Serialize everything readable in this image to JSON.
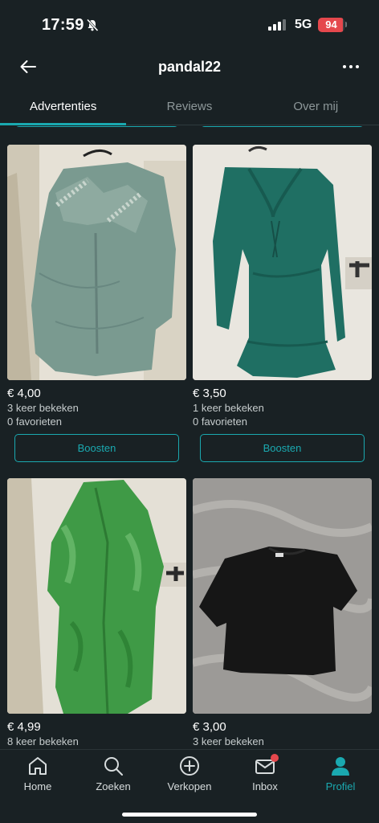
{
  "status_bar": {
    "time": "17:59",
    "network": "5G",
    "battery": "94",
    "battery_level": 0.94
  },
  "header": {
    "title": "pandal22"
  },
  "tabs": [
    {
      "label": "Advertenties",
      "active": true
    },
    {
      "label": "Reviews",
      "active": false
    },
    {
      "label": "Over mij",
      "active": false
    }
  ],
  "listings": [
    {
      "price": "€ 4,00",
      "views": "3 keer bekeken",
      "favorites": "0 favorieten",
      "boost_label": "Boosten"
    },
    {
      "price": "€ 3,50",
      "views": "1 keer bekeken",
      "favorites": "0 favorieten",
      "boost_label": "Boosten"
    },
    {
      "price": "€ 4,99",
      "views": "8 keer bekeken"
    },
    {
      "price": "€ 3,00",
      "views": "3 keer bekeken"
    }
  ],
  "bottom_nav": [
    {
      "label": "Home",
      "icon": "home-icon"
    },
    {
      "label": "Zoeken",
      "icon": "search-icon"
    },
    {
      "label": "Verkopen",
      "icon": "plus-circle-icon"
    },
    {
      "label": "Inbox",
      "icon": "mail-icon"
    },
    {
      "label": "Profiel",
      "icon": "user-icon"
    }
  ],
  "colors": {
    "accent": "#1aa9b0",
    "background": "#192124",
    "notification": "#e5484d"
  }
}
